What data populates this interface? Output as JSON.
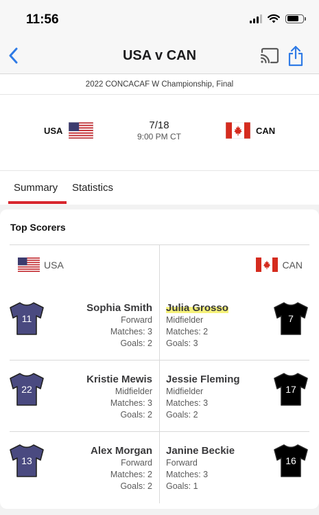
{
  "status": {
    "time": "11:56"
  },
  "nav": {
    "title": "USA v CAN"
  },
  "competition": "2022 CONCACAF W Championship, Final",
  "match": {
    "home": {
      "abbr": "USA",
      "flag": "us-flag"
    },
    "away": {
      "abbr": "CAN",
      "flag": "canada-flag"
    },
    "date": "7/18",
    "time": "9:00 PM CT"
  },
  "tabs": [
    {
      "label": "Summary",
      "active": true
    },
    {
      "label": "Statistics",
      "active": false
    }
  ],
  "top_scorers": {
    "title": "Top Scorers",
    "home_team": "USA",
    "away_team": "CAN",
    "home_jersey_color": "#4a4a80",
    "away_jersey_color": "#000000",
    "home_players": [
      {
        "number": "11",
        "name": "Sophia Smith",
        "position": "Forward",
        "matches": "Matches: 3",
        "goals": "Goals: 2"
      },
      {
        "number": "22",
        "name": "Kristie Mewis",
        "position": "Midfielder",
        "matches": "Matches: 3",
        "goals": "Goals: 2"
      },
      {
        "number": "13",
        "name": "Alex Morgan",
        "position": "Forward",
        "matches": "Matches: 2",
        "goals": "Goals: 2"
      }
    ],
    "away_players": [
      {
        "number": "7",
        "name": "Julia Grosso",
        "position": "Midfielder",
        "matches": "Matches: 2",
        "goals": "Goals: 3"
      },
      {
        "number": "17",
        "name": "Jessie Fleming",
        "position": "Midfielder",
        "matches": "Matches: 3",
        "goals": "Goals: 2"
      },
      {
        "number": "16",
        "name": "Janine Beckie",
        "position": "Forward",
        "matches": "Matches: 3",
        "goals": "Goals: 1"
      }
    ]
  }
}
